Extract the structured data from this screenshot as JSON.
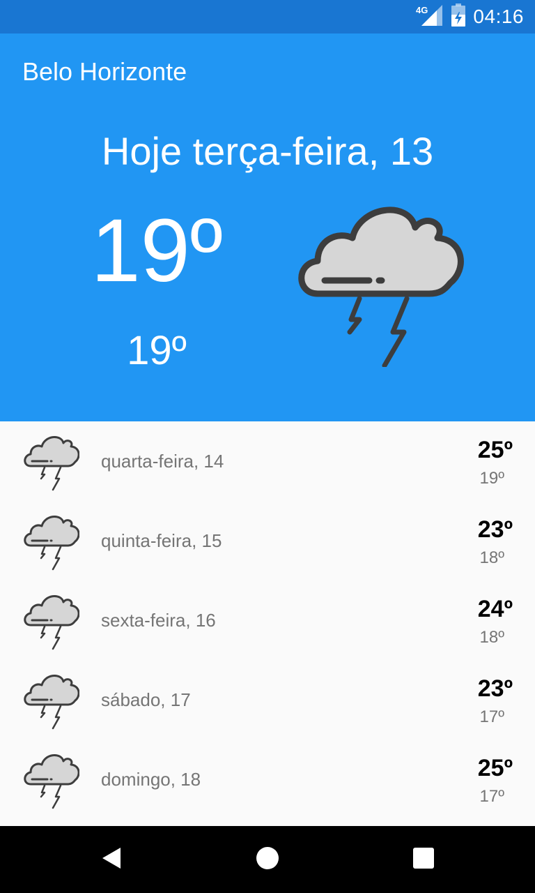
{
  "status_bar": {
    "time": "04:16",
    "network": "4G",
    "icons": [
      "signal-icon",
      "battery-icon"
    ]
  },
  "header": {
    "city": "Belo Horizonte",
    "today_label": "Hoje terça-feira, 13",
    "temp_current": "19º",
    "temp_min": "19º",
    "icon": "thunderstorm-cloud-icon"
  },
  "forecast": [
    {
      "day": "quarta-feira, 14",
      "max": "25º",
      "min": "19º",
      "icon": "thunderstorm-cloud-icon"
    },
    {
      "day": "quinta-feira, 15",
      "max": "23º",
      "min": "18º",
      "icon": "thunderstorm-cloud-icon"
    },
    {
      "day": "sexta-feira, 16",
      "max": "24º",
      "min": "18º",
      "icon": "thunderstorm-cloud-icon"
    },
    {
      "day": "sábado, 17",
      "max": "23º",
      "min": "17º",
      "icon": "thunderstorm-cloud-icon"
    },
    {
      "day": "domingo, 18",
      "max": "25º",
      "min": "17º",
      "icon": "thunderstorm-cloud-icon"
    }
  ],
  "nav_bar": {
    "buttons": [
      "back-icon",
      "home-icon",
      "recents-icon"
    ]
  },
  "colors": {
    "header": "#2196f3",
    "status_bar": "#1976d2",
    "list_bg": "#fafafa",
    "cloud_fill": "#d6d6d6",
    "cloud_stroke": "#3d3d3d"
  }
}
